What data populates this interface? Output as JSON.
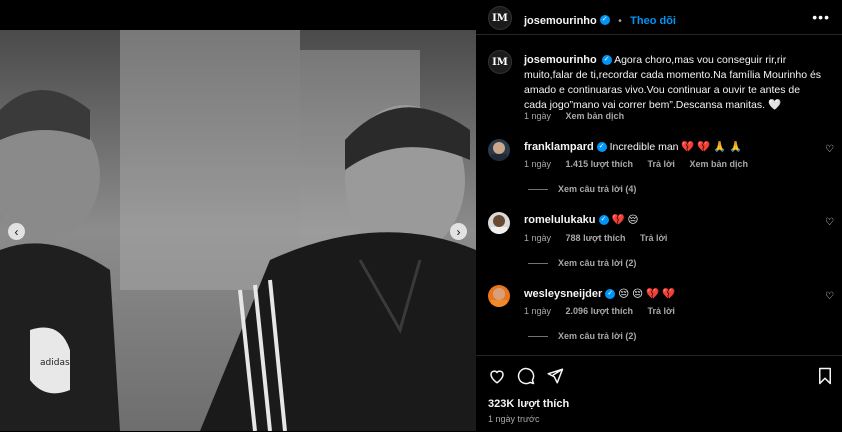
{
  "post": {
    "username": "josemourinho",
    "logo_text": "IM",
    "follow_label": "Theo dõi",
    "more_icon": "more-horizontal-icon",
    "caption_text": "Agora choro,mas vou conseguir rir,rir muito,falar de ti,recordar cada momento.Na família Mourinho és amado e continuaras vivo.Vou continuar a ouvir te antes de cada jogo”mano vai correr bem”.Descansa manitas.",
    "caption_time": "1 ngày",
    "caption_translate": "Xem bản dịch"
  },
  "comments": [
    {
      "username": "franklampard",
      "verified": true,
      "text": "Incredible man",
      "emojis": [
        "💔",
        "💔",
        "🙏",
        "🙏"
      ],
      "time": "1 ngày",
      "likes": "1.415 lượt thích",
      "reply": "Trả lời",
      "translate": "Xem bản dịch",
      "view_replies": "Xem câu trả lời (4)"
    },
    {
      "username": "romelulukaku",
      "verified": true,
      "text": "",
      "emojis": [
        "💔",
        "😔"
      ],
      "time": "1 ngày",
      "likes": "788 lượt thích",
      "reply": "Trả lời",
      "view_replies": "Xem câu trả lời (2)"
    },
    {
      "username": "wesleysneijder",
      "verified": true,
      "text": "",
      "emojis": [
        "😔",
        "😔",
        "💔",
        "💔"
      ],
      "time": "1 ngày",
      "likes": "2.096 lượt thích",
      "reply": "Trả lời",
      "view_replies": "Xem câu trả lời (2)"
    }
  ],
  "footer": {
    "likes": "323K lượt thích",
    "ago": "1 ngày trước"
  },
  "colors": {
    "accent": "#0095f6",
    "background": "#000000",
    "muted": "#a8a8a8",
    "heart": "#ff3040"
  }
}
